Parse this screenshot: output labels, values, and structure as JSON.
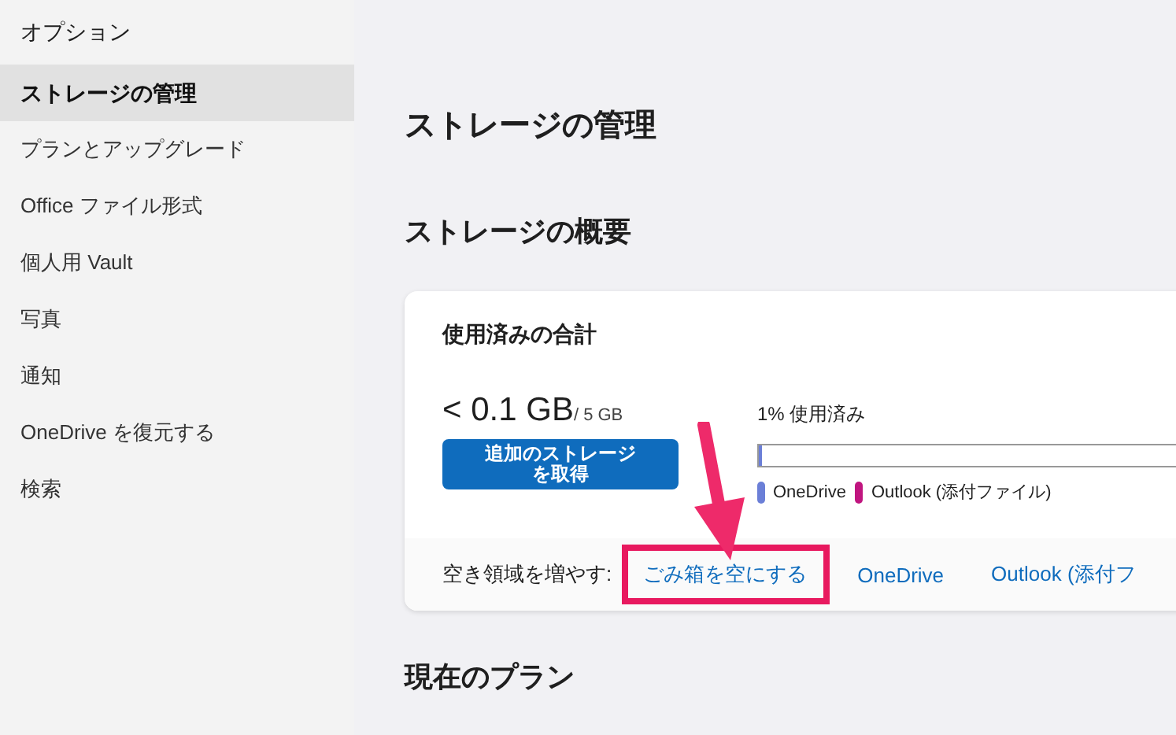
{
  "sidebar": {
    "title": "オプション",
    "items": [
      {
        "label": "ストレージの管理",
        "selected": true
      },
      {
        "label": "プランとアップグレード",
        "selected": false
      },
      {
        "label": "Office ファイル形式",
        "selected": false
      },
      {
        "label": "個人用 Vault",
        "selected": false
      },
      {
        "label": "写真",
        "selected": false
      },
      {
        "label": "通知",
        "selected": false
      },
      {
        "label": "OneDrive を復元する",
        "selected": false
      },
      {
        "label": "検索",
        "selected": false
      }
    ]
  },
  "main": {
    "title": "ストレージの管理",
    "overview_heading": "ストレージの概要",
    "card": {
      "title": "使用済みの合計",
      "used": "< 0.1 GB",
      "total": "/ 5 GB",
      "button": "追加のストレージを取得",
      "usage_label": "1% 使用済み",
      "segments": [
        {
          "name": "OneDrive",
          "color": "#6b7fd7",
          "level": 0.006
        },
        {
          "name": "Outlook (添付ファイル)",
          "color": "#c0157f"
        }
      ],
      "footer_label": "空き領域を増やす:",
      "links": [
        {
          "label": "ごみ箱を空にする",
          "highlighted": true
        },
        {
          "label": "OneDrive",
          "highlighted": false
        },
        {
          "label": "Outlook (添付フ",
          "highlighted": false
        }
      ]
    },
    "plan_heading": "現在のプラン"
  }
}
